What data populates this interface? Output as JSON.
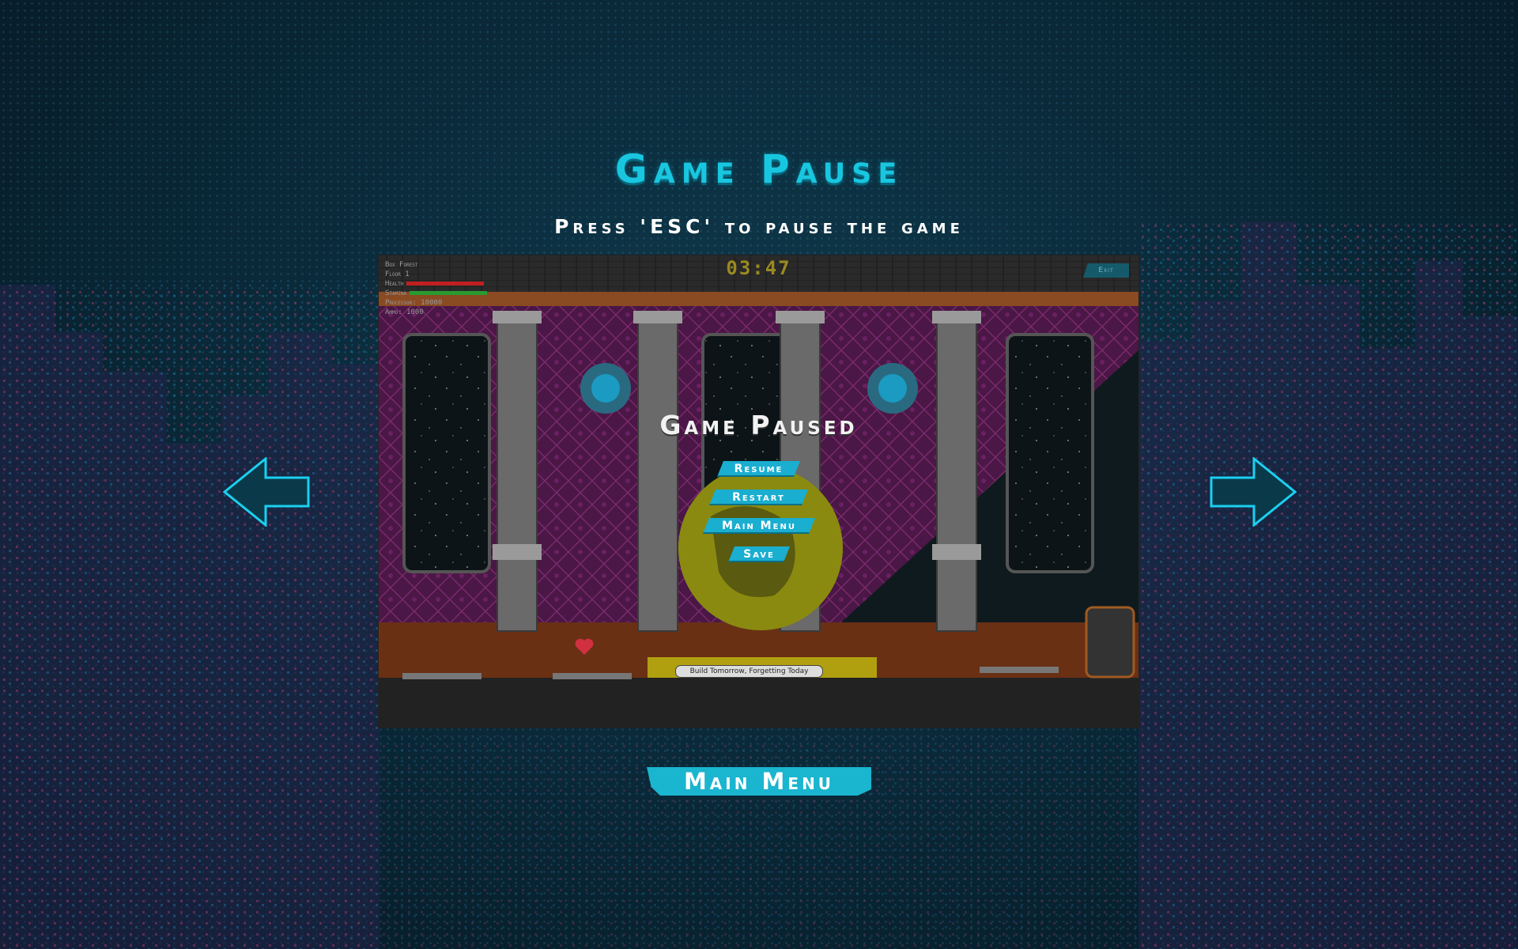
{
  "page": {
    "title": "Game Pause",
    "subtitle": "Press 'ESC' to pause the game"
  },
  "preview": {
    "hud": {
      "location": "Box Forest",
      "floor": "Floor 1",
      "health_label": "Health",
      "stamina_label": "Stamina",
      "processor": "Processor: 10000",
      "ammo": "Ammo: 1000"
    },
    "timer": "03:47",
    "exit_label": "Exit",
    "paused_title": "Game Paused",
    "menu": {
      "resume": "Resume",
      "restart": "Restart",
      "main_menu": "Main Menu",
      "save": "Save"
    },
    "caption": "Build Tomorrow, Forgetting Today"
  },
  "nav": {
    "prev_icon": "arrow-left-icon",
    "next_icon": "arrow-right-icon"
  },
  "footer": {
    "main_menu_label": "Main Menu"
  },
  "colors": {
    "accent": "#1ab5cf",
    "title": "#19c6e0",
    "background": "#0a2a3a",
    "wallpaper": "#4a1a4a"
  }
}
